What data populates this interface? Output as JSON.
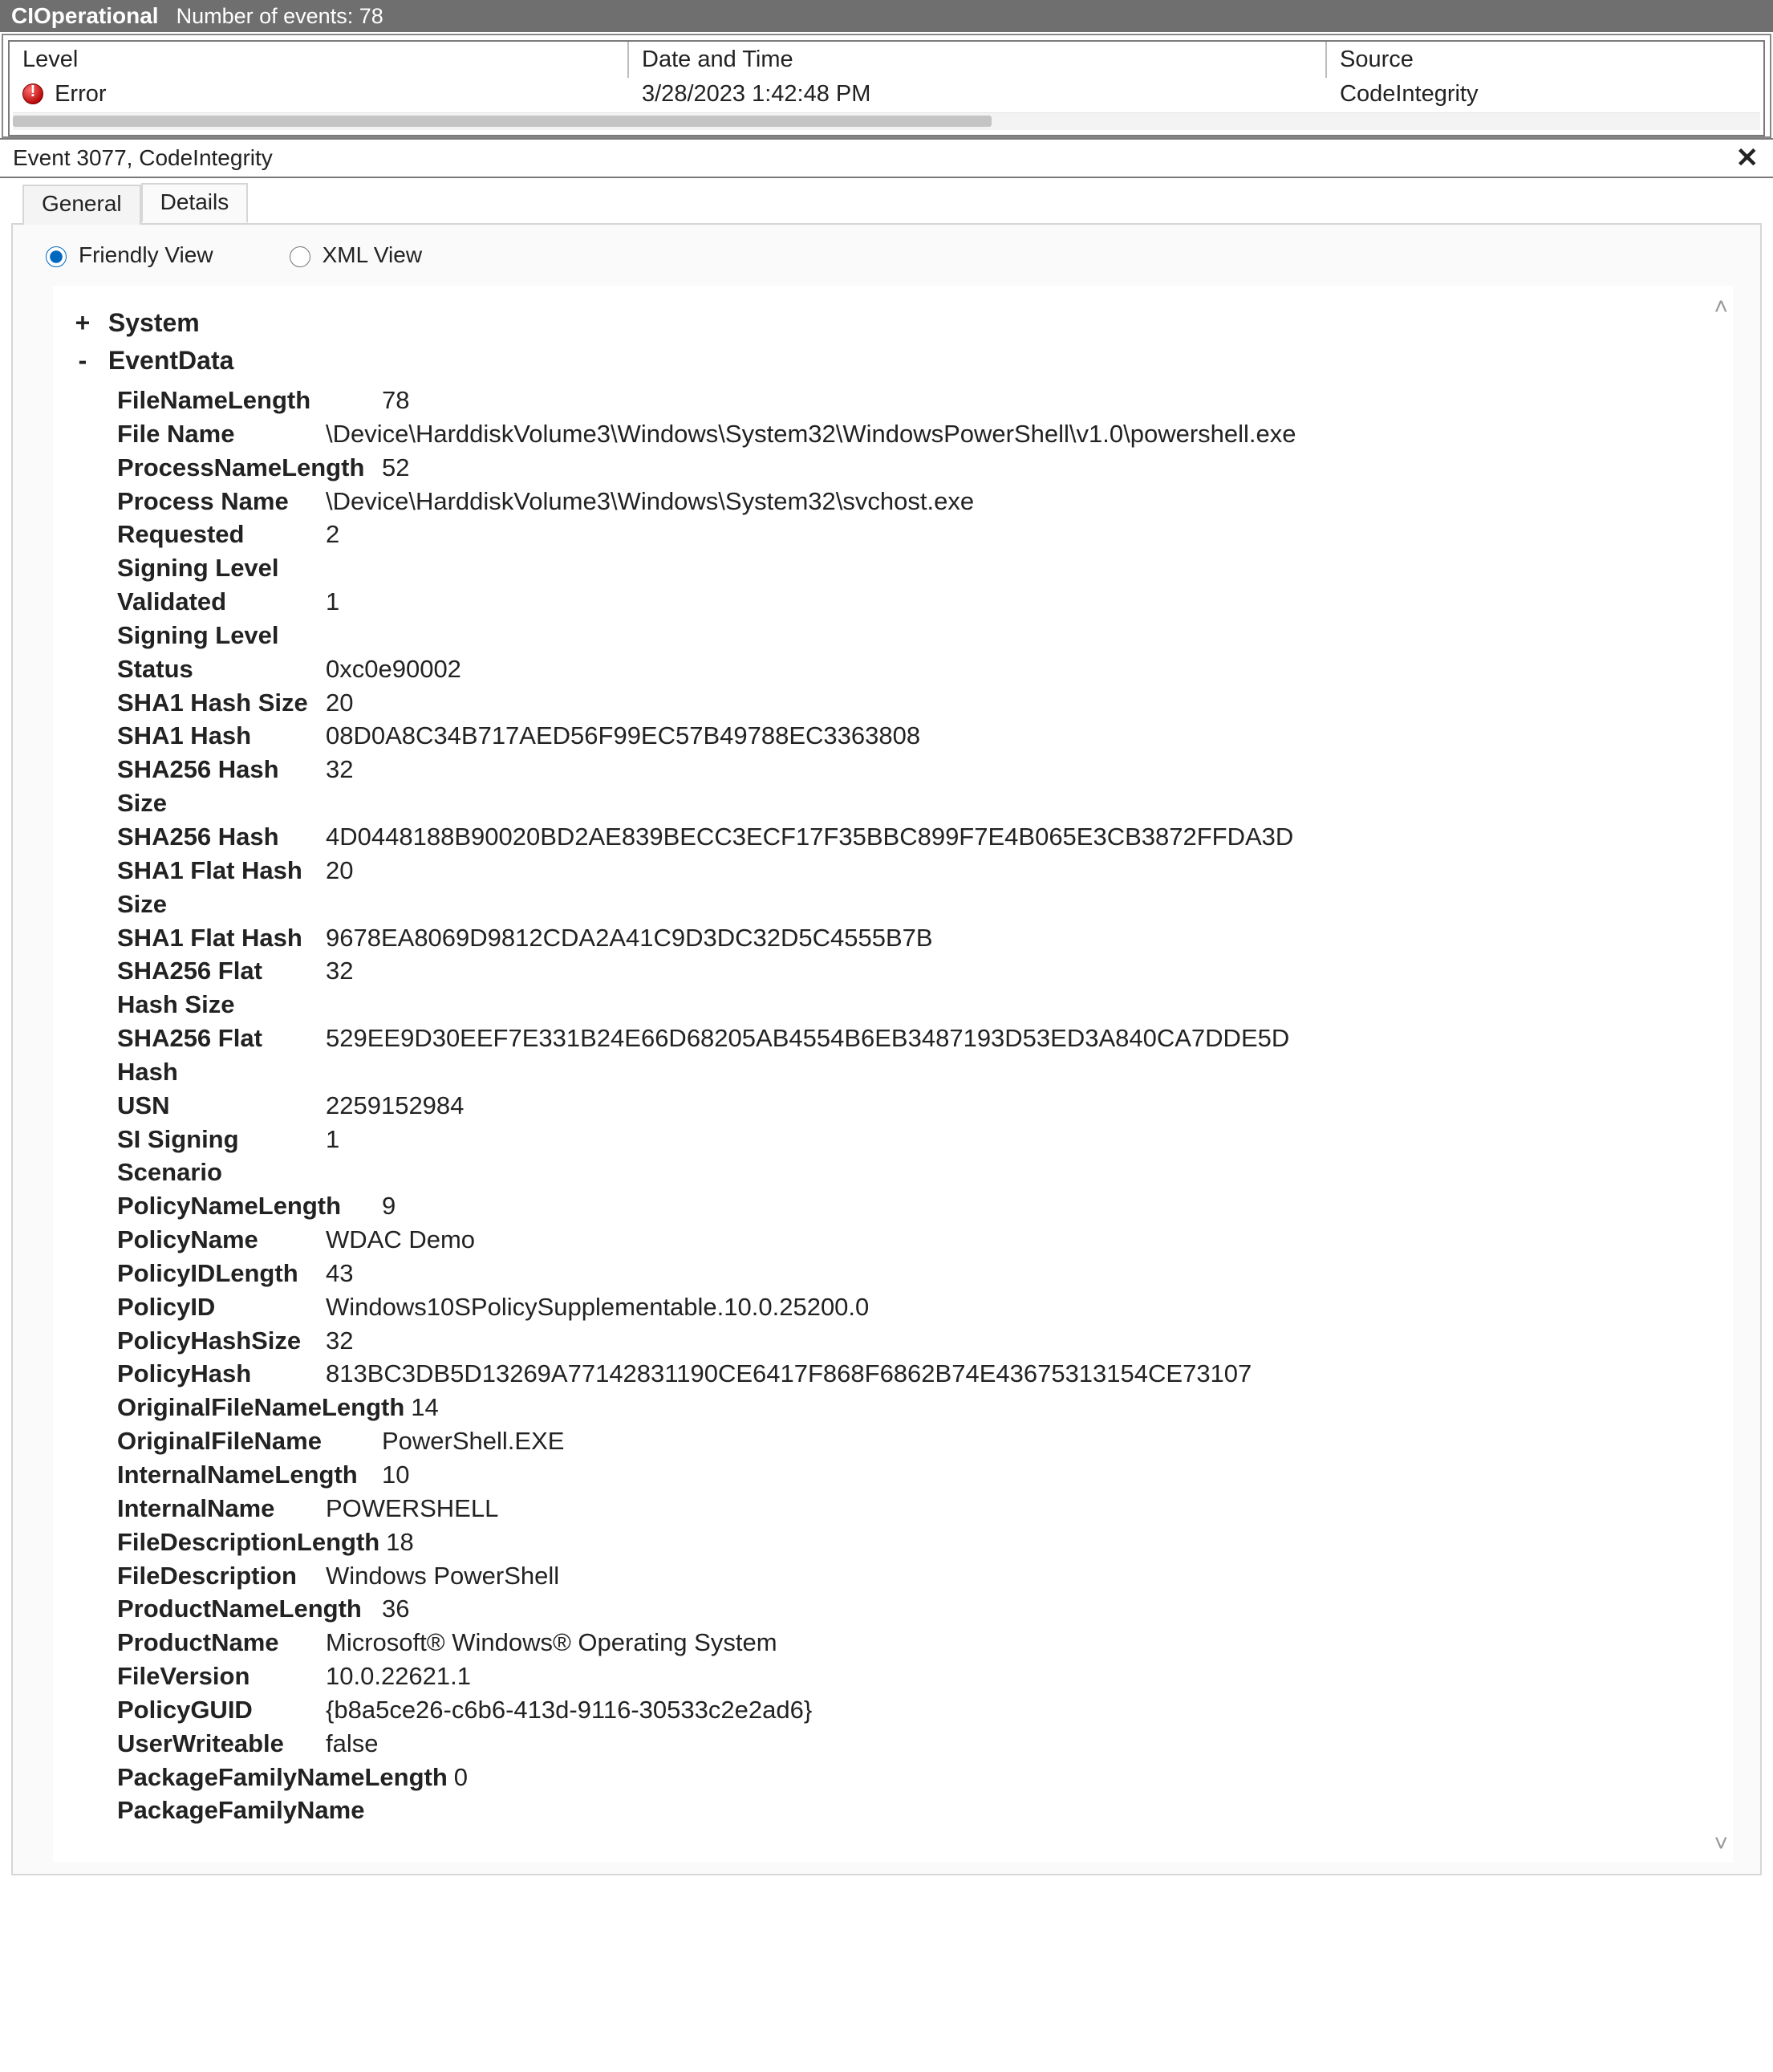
{
  "titlebar": {
    "op_label": "CIOperational",
    "count_label": "Number of events: 78"
  },
  "grid": {
    "headers": {
      "level": "Level",
      "date": "Date and Time",
      "source": "Source"
    },
    "row": {
      "level_text": "Error",
      "date": "3/28/2023 1:42:48 PM",
      "source": "CodeIntegrity"
    }
  },
  "event_header": "Event 3077, CodeIntegrity",
  "tabs": {
    "general": "General",
    "details": "Details"
  },
  "radio": {
    "friendly": "Friendly View",
    "xml": "XML View"
  },
  "tree": {
    "system_label": "System",
    "eventdata_label": "EventData"
  },
  "eventdata": [
    {
      "k": "FileNameLength",
      "v": "78",
      "tight": true
    },
    {
      "k": "File Name",
      "v": "\\Device\\HarddiskVolume3\\Windows\\System32\\WindowsPowerShell\\v1.0\\powershell.exe"
    },
    {
      "k": "ProcessNameLength",
      "v": "52",
      "tight": true
    },
    {
      "k": "Process Name",
      "v": "\\Device\\HarddiskVolume3\\Windows\\System32\\svchost.exe"
    },
    {
      "k": "Requested Signing Level",
      "v": "2"
    },
    {
      "k": "Validated Signing Level",
      "v": "1"
    },
    {
      "k": "Status",
      "v": "0xc0e90002"
    },
    {
      "k": "SHA1 Hash Size",
      "v": "20"
    },
    {
      "k": "SHA1 Hash",
      "v": "08D0A8C34B717AED56F99EC57B49788EC3363808"
    },
    {
      "k": "SHA256 Hash Size",
      "v": "32"
    },
    {
      "k": "SHA256 Hash",
      "v": "4D0448188B90020BD2AE839BECC3ECF17F35BBC899F7E4B065E3CB3872FFDA3D"
    },
    {
      "k": "SHA1 Flat Hash Size",
      "v": "20"
    },
    {
      "k": "SHA1 Flat Hash",
      "v": "9678EA8069D9812CDA2A41C9D3DC32D5C4555B7B"
    },
    {
      "k": "SHA256 Flat Hash Size",
      "v": "32"
    },
    {
      "k": "SHA256 Flat Hash",
      "v": "529EE9D30EEF7E331B24E66D68205AB4554B6EB3487193D53ED3A840CA7DDE5D"
    },
    {
      "k": "USN",
      "v": "2259152984"
    },
    {
      "k": "SI Signing Scenario",
      "v": "1"
    },
    {
      "k": "PolicyNameLength",
      "v": "9",
      "tight": true
    },
    {
      "k": "PolicyName",
      "v": "WDAC Demo"
    },
    {
      "k": "PolicyIDLength",
      "v": "43"
    },
    {
      "k": "PolicyID",
      "v": "Windows10SPolicySupplementable.10.0.25200.0"
    },
    {
      "k": "PolicyHashSize",
      "v": "32"
    },
    {
      "k": "PolicyHash",
      "v": "813BC3DB5D13269A77142831190CE6417F868F6862B74E43675313154CE73107"
    },
    {
      "k": "OriginalFileNameLength",
      "v": "14",
      "tight": true
    },
    {
      "k": "OriginalFileName",
      "v": "PowerShell.EXE",
      "tight": true
    },
    {
      "k": "InternalNameLength",
      "v": "10",
      "tight": true
    },
    {
      "k": "InternalName",
      "v": "POWERSHELL"
    },
    {
      "k": "FileDescriptionLength",
      "v": "18",
      "tight": true
    },
    {
      "k": "FileDescription",
      "v": "Windows PowerShell"
    },
    {
      "k": "ProductNameLength",
      "v": "36",
      "tight": true
    },
    {
      "k": "ProductName",
      "v": "Microsoft® Windows® Operating System"
    },
    {
      "k": "FileVersion",
      "v": "10.0.22621.1"
    },
    {
      "k": "PolicyGUID",
      "v": "{b8a5ce26-c6b6-413d-9116-30533c2e2ad6}"
    },
    {
      "k": "UserWriteable",
      "v": "false"
    },
    {
      "k": "PackageFamilyNameLength",
      "v": "0",
      "tight": true
    },
    {
      "k": "PackageFamilyName",
      "v": "",
      "tight": true
    }
  ]
}
